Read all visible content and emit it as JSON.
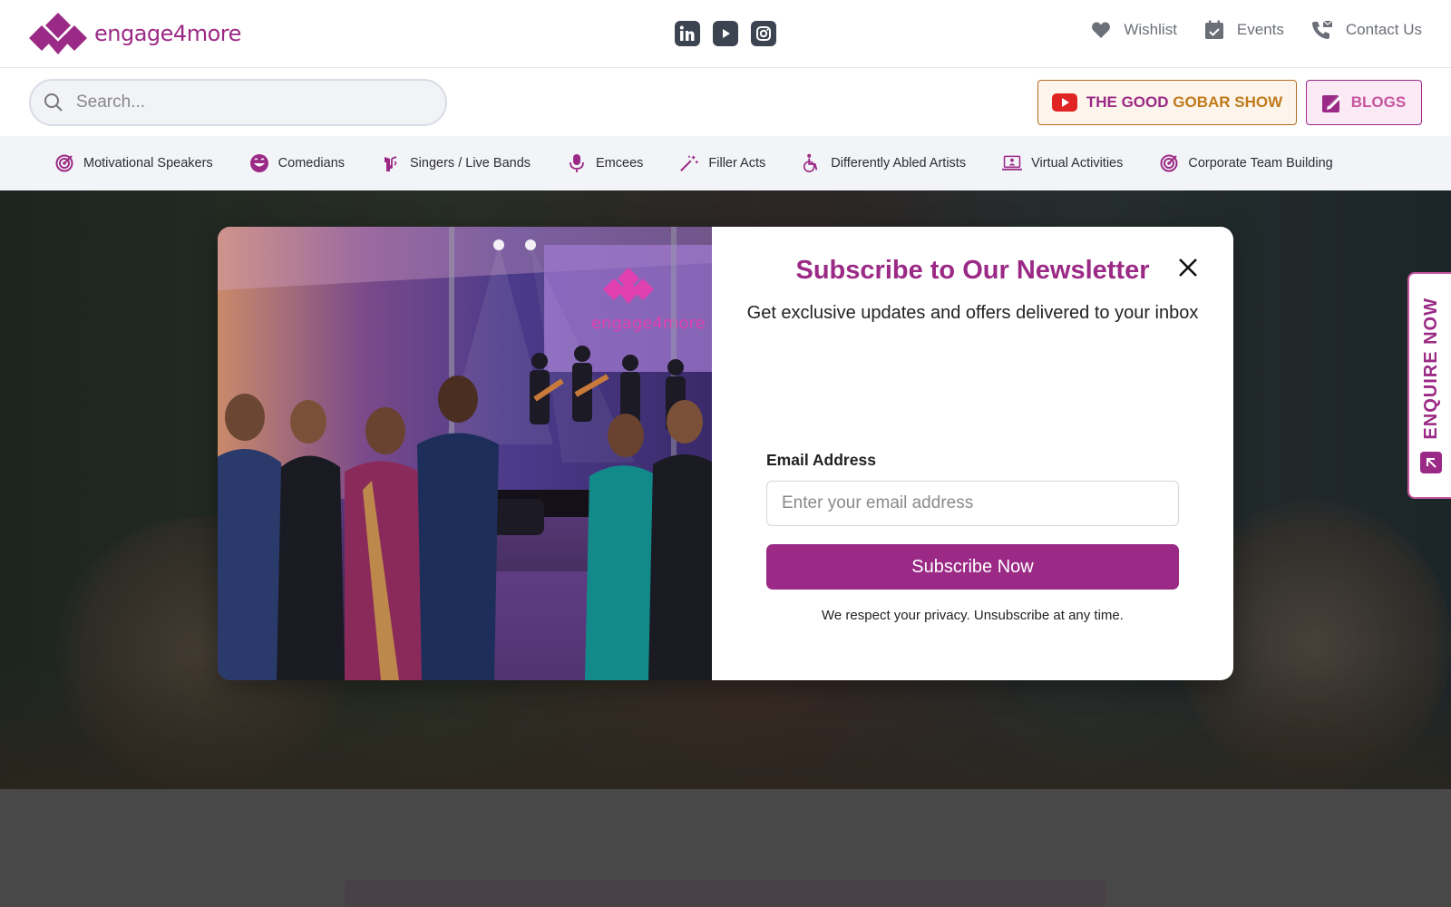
{
  "brand": {
    "name": "engage4more",
    "color": "#9b2a86"
  },
  "social": [
    {
      "name": "linkedin",
      "icon": "linkedin-icon"
    },
    {
      "name": "youtube",
      "icon": "youtube-icon"
    },
    {
      "name": "instagram",
      "icon": "instagram-icon"
    }
  ],
  "toplinks": {
    "wishlist": "Wishlist",
    "events": "Events",
    "contact": "Contact Us"
  },
  "search": {
    "placeholder": "Search..."
  },
  "buttons": {
    "gobar_part1": "THE GOOD ",
    "gobar_part2": "GOBAR SHOW",
    "blogs": "BLOGS"
  },
  "nav": {
    "items": [
      {
        "label": "Motivational Speakers",
        "icon": "target-icon"
      },
      {
        "label": "Comedians",
        "icon": "smile-icon"
      },
      {
        "label": "Singers / Live Bands",
        "icon": "singer-icon"
      },
      {
        "label": "Emcees",
        "icon": "microphone-icon"
      },
      {
        "label": "Filler Acts",
        "icon": "magic-wand-icon"
      },
      {
        "label": "Differently Abled Artists",
        "icon": "wheelchair-icon"
      },
      {
        "label": "Virtual Activities",
        "icon": "laptop-icon"
      },
      {
        "label": "Corporate Team Building",
        "icon": "target-icon"
      }
    ]
  },
  "enquire": {
    "label": "ENQUIRE NOW"
  },
  "modal": {
    "title": "Subscribe to Our Newsletter",
    "subtitle": "Get exclusive updates and offers delivered to your inbox",
    "email_label": "Email Address",
    "email_placeholder": "Enter your email address",
    "email_value": "",
    "submit_label": "Subscribe Now",
    "privacy": "We respect your privacy. Unsubscribe at any time.",
    "photo_logo_text": "engage4more"
  }
}
